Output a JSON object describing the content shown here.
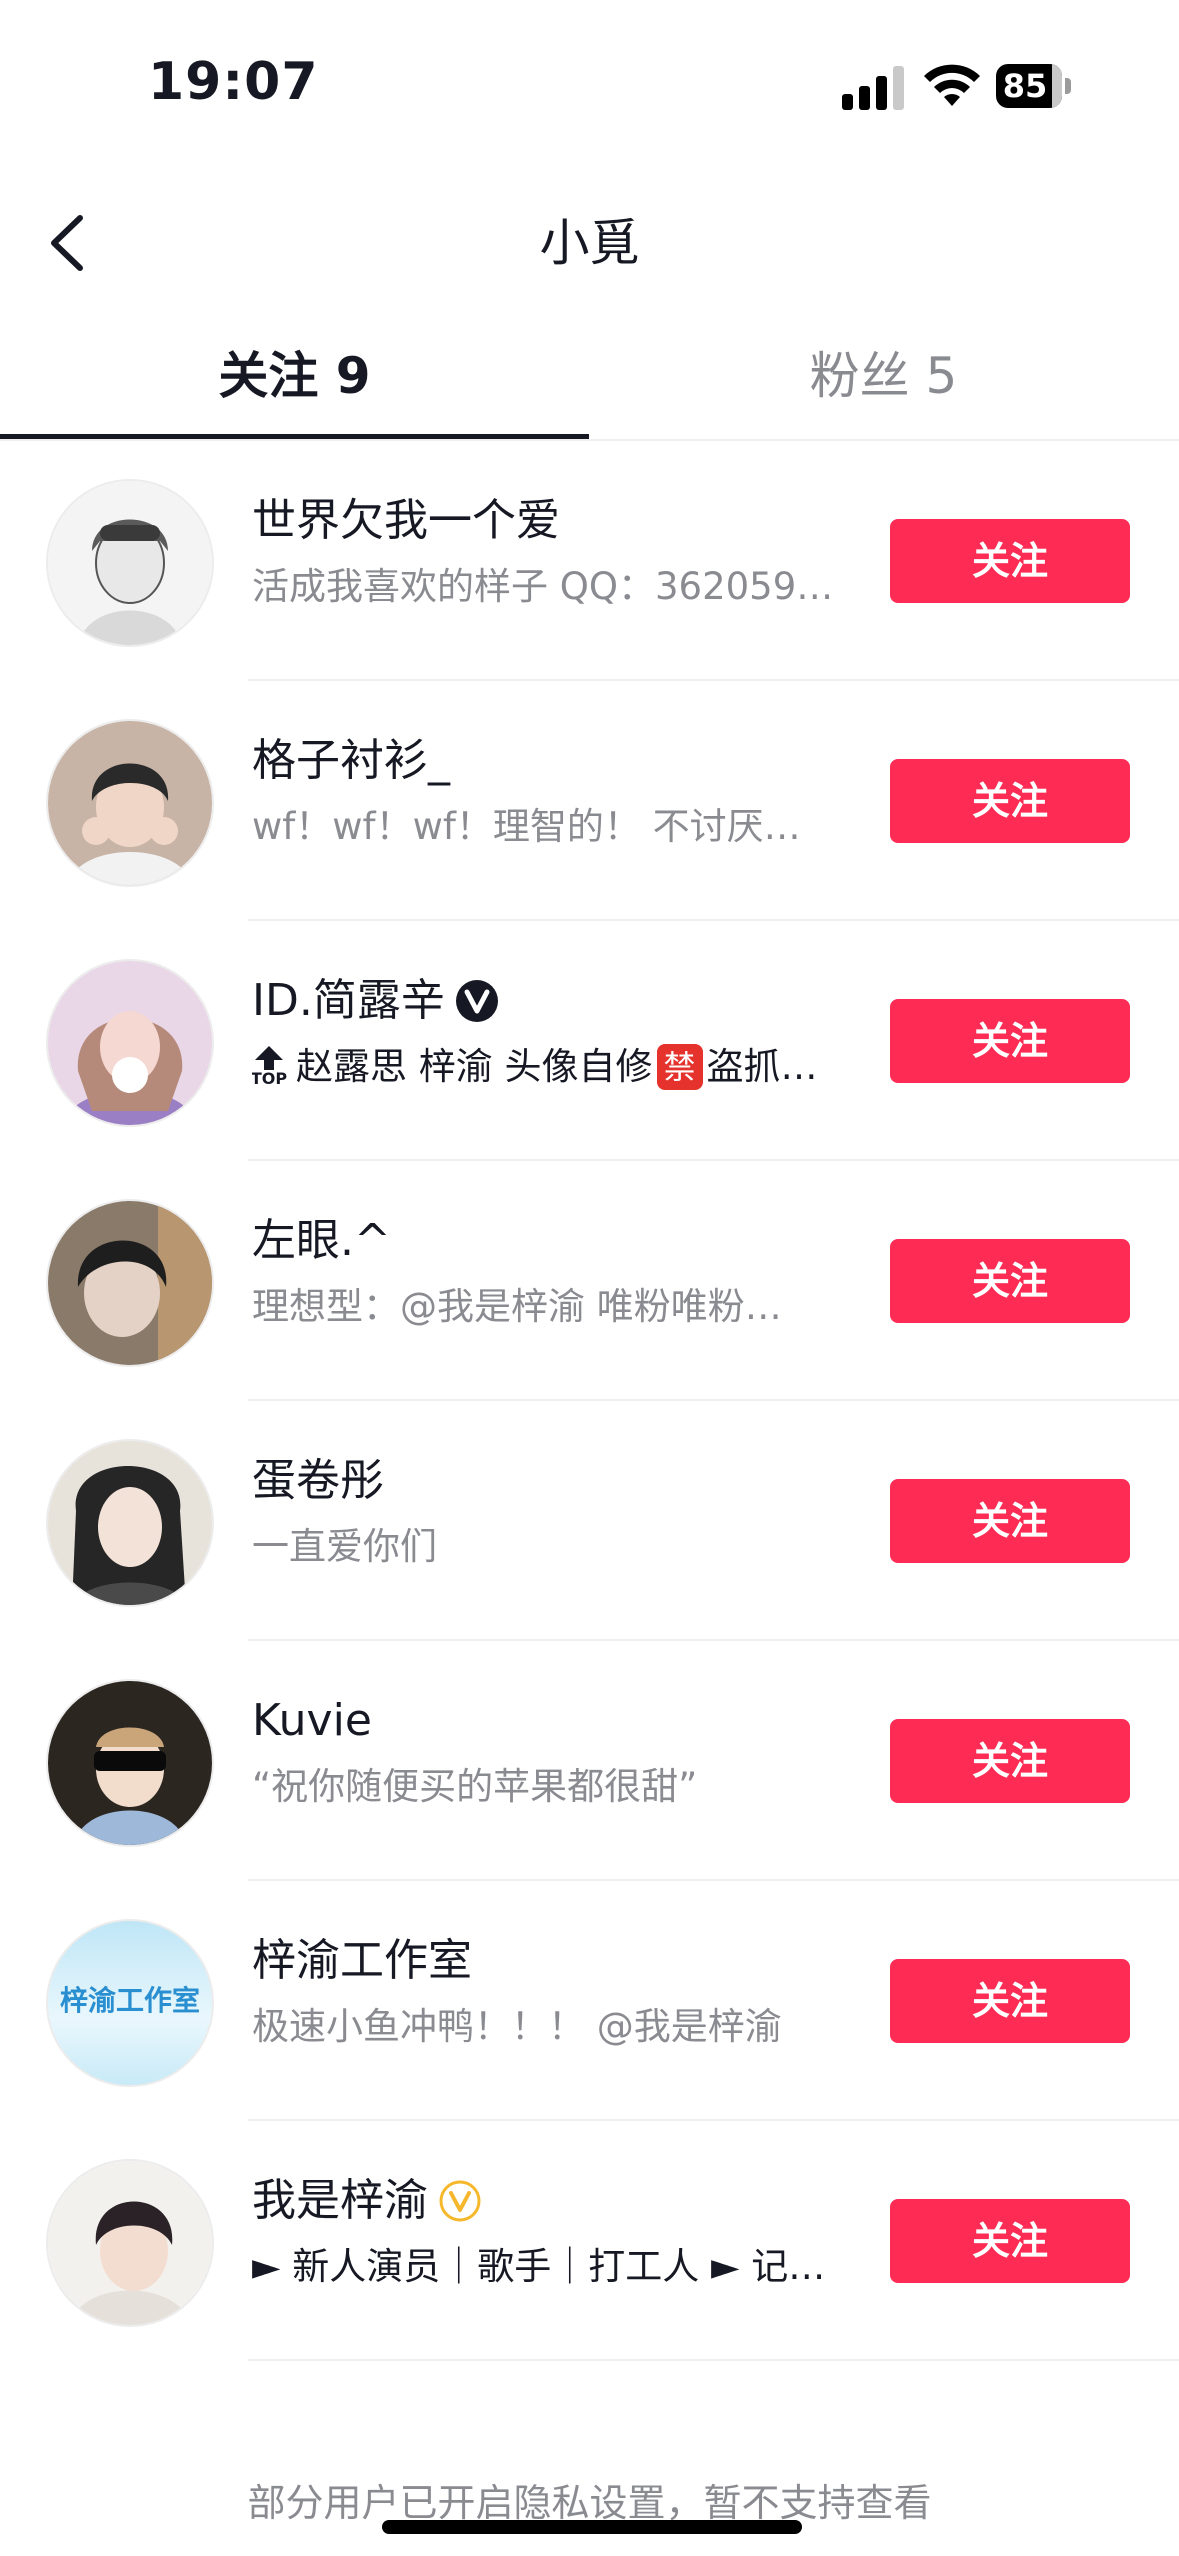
{
  "status_bar": {
    "time": "19:07",
    "battery": "85"
  },
  "nav": {
    "title": "小覓"
  },
  "tabs": [
    {
      "label": "关注 9",
      "active": true
    },
    {
      "label": "粉丝 5",
      "active": false
    }
  ],
  "list": [
    {
      "name": "世界欠我一个爱",
      "bio": "活成我喜欢的样子 QQ：362059…",
      "button": "关注"
    },
    {
      "name": "格子衬衫_",
      "bio": "wf！wf！wf！理智的！ 不讨厌…",
      "button": "关注"
    },
    {
      "name": "ID.简露辛",
      "bio_top_label": "TOP",
      "bio_pre": "赵露思 梓渝 头像自修",
      "bio_ban": "禁",
      "bio_post": "盗抓…",
      "button": "关注"
    },
    {
      "name": "左眼.^",
      "bio": "理想型：@我是梓渝 唯粉唯粉…",
      "button": "关注"
    },
    {
      "name": "蛋卷彤",
      "bio": "一直爱你们",
      "button": "关注"
    },
    {
      "name": "Kuvie",
      "bio": "“祝你随便买的苹果都很甜”",
      "button": "关注"
    },
    {
      "name": "梓渝工作室",
      "avatar_text": "梓渝工作室",
      "bio": "极速小鱼冲鸭！！！ @我是梓渝",
      "button": "关注"
    },
    {
      "name": "我是梓渝",
      "bio": "► 新人演员｜歌手｜打工人 ► 记…",
      "button": "关注"
    }
  ],
  "footer": {
    "note": "部分用户已开启隐私设置，暂不支持查看"
  },
  "colors": {
    "accent": "#fe2c55",
    "text": "#161823",
    "secondary": "#8a8b91"
  }
}
